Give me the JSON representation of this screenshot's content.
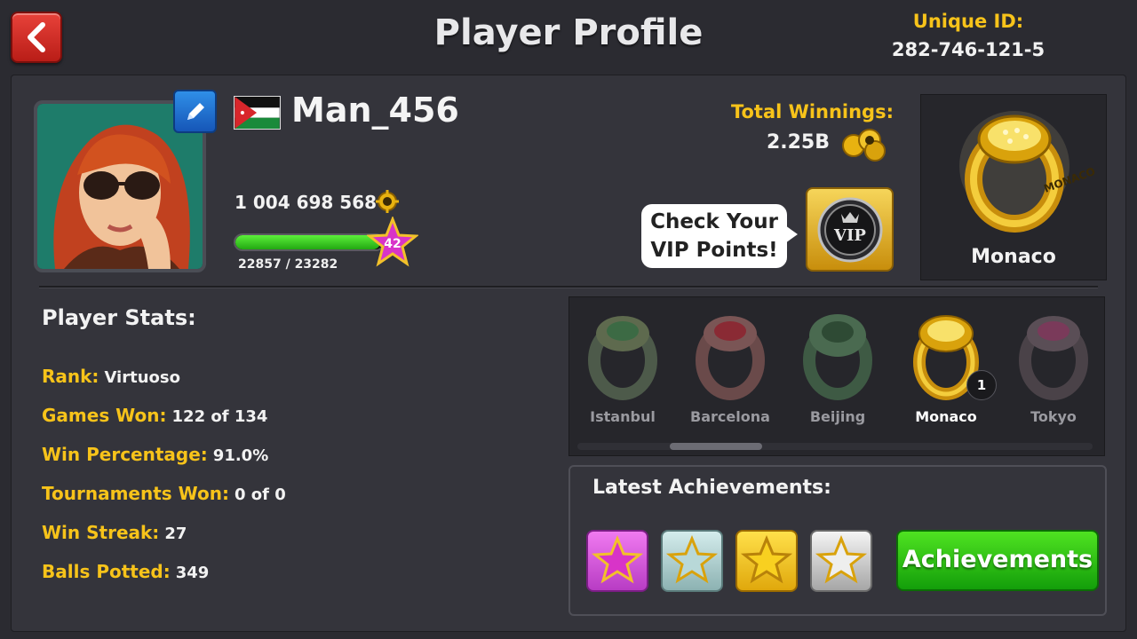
{
  "header": {
    "title": "Player Profile",
    "unique_id_label": "Unique ID:",
    "unique_id": "282-746-121-5"
  },
  "player": {
    "name": "Man_456",
    "flag": "Jordan",
    "coins": "1 004 698 568",
    "level": "42",
    "xp_text": "22857 / 23282",
    "xp_progress": 0.982
  },
  "winnings": {
    "label": "Total Winnings:",
    "value": "2.25B"
  },
  "vip": {
    "prompt_line1": "Check Your",
    "prompt_line2": "VIP Points!",
    "badge_text": "VIP"
  },
  "featured_ring": {
    "label": "Monaco",
    "ring_text": "MONACO"
  },
  "stats": {
    "title": "Player Stats:",
    "rows": [
      {
        "label": "Rank:",
        "value": "Virtuoso"
      },
      {
        "label": "Games Won:",
        "value": "122 of 134"
      },
      {
        "label": "Win Percentage:",
        "value": "91.0%"
      },
      {
        "label": "Tournaments Won:",
        "value": "0 of 0"
      },
      {
        "label": "Win Streak:",
        "value": "27"
      },
      {
        "label": "Balls Potted:",
        "value": "349"
      }
    ]
  },
  "rings": {
    "items": [
      {
        "label": "Istanbul",
        "owned": false
      },
      {
        "label": "Barcelona",
        "owned": false
      },
      {
        "label": "Beijing",
        "owned": false
      },
      {
        "label": "Monaco",
        "owned": true,
        "count": "1"
      },
      {
        "label": "Tokyo",
        "owned": false
      }
    ]
  },
  "achievements": {
    "title": "Latest Achievements:",
    "button_label": "Achievements",
    "badges": [
      {
        "icon": "pink-star-icon"
      },
      {
        "icon": "silver-star-icon"
      },
      {
        "icon": "gold-star-icon"
      },
      {
        "icon": "white-star-icon"
      }
    ]
  },
  "colors": {
    "background": "#2b2b31",
    "label_yellow": "#f7c31a",
    "back_red": "#d9302a",
    "achievements_green": "#2fc316"
  }
}
